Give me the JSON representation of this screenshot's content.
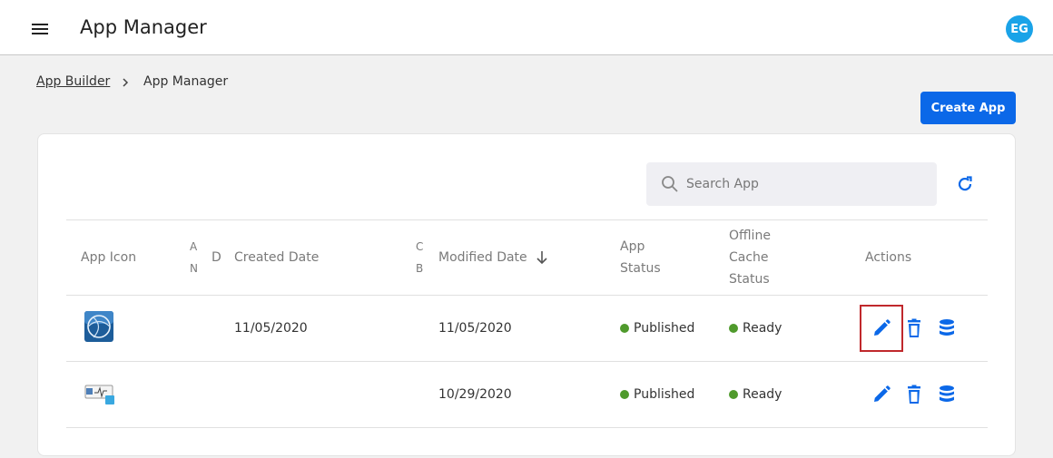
{
  "header": {
    "title": "App Manager",
    "avatar_initials": "EG"
  },
  "breadcrumb": {
    "parent": "App Builder",
    "current": "App Manager"
  },
  "toolbar": {
    "create_label": "Create App"
  },
  "search": {
    "placeholder": "Search App",
    "value": ""
  },
  "table": {
    "columns": {
      "app_icon": "App Icon",
      "app_name_partial_1": "A",
      "app_name_partial_2": "N",
      "description_partial": "D",
      "created_date": "Created Date",
      "created_by_partial_1": "C",
      "created_by_partial_2": "B",
      "modified_date": "Modified Date",
      "app_status_1": "App",
      "app_status_2": "Status",
      "offline_1": "Offline",
      "offline_2": "Cache",
      "offline_3": "Status",
      "actions": "Actions"
    },
    "rows": [
      {
        "icon": "globe-app-icon",
        "created": "11/05/2020",
        "modified": "11/05/2020",
        "status": "Published",
        "cache": "Ready"
      },
      {
        "icon": "monitor-app-icon",
        "created": "",
        "modified": "10/29/2020",
        "status": "Published",
        "cache": "Ready"
      }
    ]
  },
  "colors": {
    "accent": "#0b68e8",
    "avatar": "#1aa3e8",
    "status_green": "#4f9a2c",
    "highlight": "#c0282c"
  }
}
